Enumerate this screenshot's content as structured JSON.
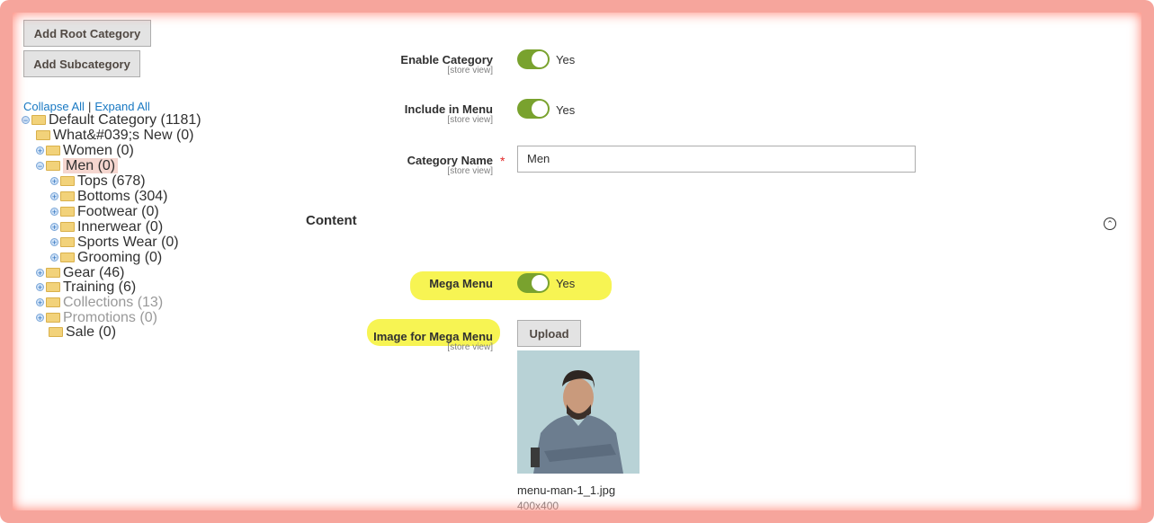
{
  "buttons": {
    "add_root": "Add Root Category",
    "add_sub": "Add Subcategory",
    "upload": "Upload"
  },
  "tree_links": {
    "collapse": "Collapse All",
    "separator": "|",
    "expand": "Expand All"
  },
  "tree": {
    "default": "Default Category (1181)",
    "whats_new": "What&#039;s New (0)",
    "women": "Women (0)",
    "men": "Men (0)",
    "tops": "Tops (678)",
    "bottoms": "Bottoms (304)",
    "footwear": "Footwear (0)",
    "innerwear": "Innerwear (0)",
    "sports": "Sports Wear (0)",
    "grooming": "Grooming (0)",
    "gear": "Gear (46)",
    "training": "Training (6)",
    "collections": "Collections (13)",
    "promotions": "Promotions (0)",
    "sale": "Sale (0)"
  },
  "form": {
    "store_view": "[store view]",
    "enable_label": "Enable Category",
    "enable_value": "Yes",
    "menu_label": "Include in Menu",
    "menu_value": "Yes",
    "name_label": "Category Name",
    "required_mark": "*",
    "name_value": "Men",
    "content_title": "Content",
    "mega_label": "Mega Menu",
    "mega_value": "Yes",
    "image_label": "Image for Mega Menu",
    "file_name": "menu-man-1_1.jpg",
    "file_dims": "400x400"
  },
  "colors": {
    "toggle_on": "#79a22e",
    "link": "#1979c3",
    "highlight": "#f7f34a",
    "frame": "#f6a59c"
  }
}
